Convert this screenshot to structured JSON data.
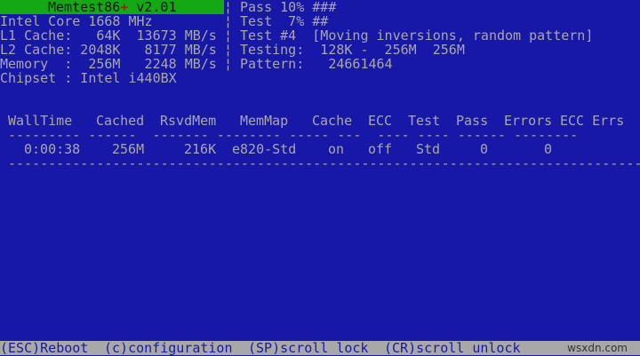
{
  "header": {
    "title": "Memtest86",
    "plus": "+",
    "version": " v2.01"
  },
  "system": {
    "cpu": "Intel Core 1668 MHz",
    "l1": "L1 Cache:   64K  13673 MB/s",
    "l2": "L2 Cache: 2048K   8177 MB/s",
    "memory": "Memory  :  256M   2248 MB/s",
    "chipset": "Chipset : Intel i440BX"
  },
  "separator": "¦",
  "status": {
    "pass": "Pass 10% ###",
    "test": "Test  7% ##",
    "test_num": "Test #4  [Moving inversions, random pattern]",
    "testing": "Testing:  128K -  256M  256M",
    "pattern": "Pattern:   24661464"
  },
  "table": {
    "headers": [
      "WallTime",
      "Cached",
      "RsvdMem",
      "MemMap",
      "Cache",
      "ECC",
      "Test",
      "Pass",
      "Errors",
      "ECC Errs"
    ],
    "underline": "--------- ------  ------- -------- ----- ---  ---- ---- ------ --------",
    "row": [
      "0:00:38",
      "256M",
      "216K",
      "e820-Std",
      "on",
      "off",
      "Std",
      "0",
      "0"
    ],
    "rule": "-------------------------------------------------------------------------------"
  },
  "footer": {
    "reboot": "(ESC)Reboot",
    "config": "(c)configuration",
    "scroll_lock": "(SP)scroll_lock",
    "scroll_unlock": "(CR)scroll_unlock",
    "watermark": "wsxdn.com"
  }
}
